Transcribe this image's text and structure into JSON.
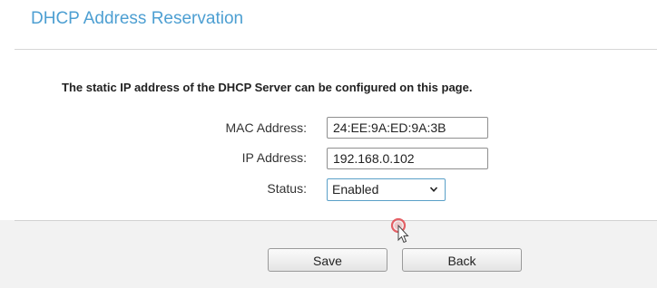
{
  "page": {
    "title": "DHCP Address Reservation",
    "description": "The static IP address of the DHCP Server can be configured on this page."
  },
  "form": {
    "mac_label": "MAC Address:",
    "mac_value": "24:EE:9A:ED:9A:3B",
    "ip_label": "IP Address:",
    "ip_value": "192.168.0.102",
    "status_label": "Status:",
    "status_value": "Enabled"
  },
  "actions": {
    "save_label": "Save",
    "back_label": "Back"
  },
  "icons": {
    "status_dropdown": "chevron-down-icon",
    "pointer": "mouse-cursor-icon"
  },
  "colors": {
    "title": "#4d9fd2",
    "select_border": "#5aa0c8",
    "cursor_highlight": "#e0474c"
  }
}
